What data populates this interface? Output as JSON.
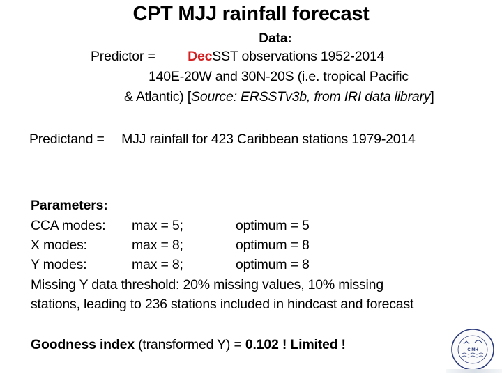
{
  "title": "CPT MJJ rainfall forecast",
  "data_header": "Data:",
  "predictor": {
    "label": "Predictor =",
    "highlight": "Dec",
    "text": "SST observations 1952-2014",
    "line2": "140E-20W and 30N-20S (i.e. tropical Pacific",
    "line3_prefix": "& Atlantic) [",
    "line3_source": "Source: ERSSTv3b, from IRI data library",
    "line3_suffix": "]"
  },
  "predictand": {
    "label": "Predictand =",
    "text": "MJJ rainfall  for 423 Caribbean stations 1979-2014"
  },
  "parameters": {
    "header": "Parameters:",
    "rows": [
      {
        "name": "CCA modes:",
        "max": "max = 5;",
        "optimum": "optimum = 5"
      },
      {
        "name": "X modes:",
        "max": "max = 8;",
        "optimum": "optimum = 8"
      },
      {
        "name": "Y modes:",
        "max": "max = 8;",
        "optimum": "optimum = 8"
      }
    ],
    "missing_line1": "Missing Y data threshold: 20% missing values, 10% missing",
    "missing_line2": "stations, leading to 236 stations included in hindcast and forecast"
  },
  "goodness": {
    "label": "Goodness index",
    "qualifier": " (transformed Y) = ",
    "value": "0.102",
    "verdict": " ! Limited !"
  },
  "logo": {
    "name": "CIMH",
    "ring_text": "Caribbean Institute for Meteorology and Hydrology"
  },
  "colors": {
    "highlight": "#d42020",
    "text": "#000000",
    "background": "#ffffff"
  }
}
